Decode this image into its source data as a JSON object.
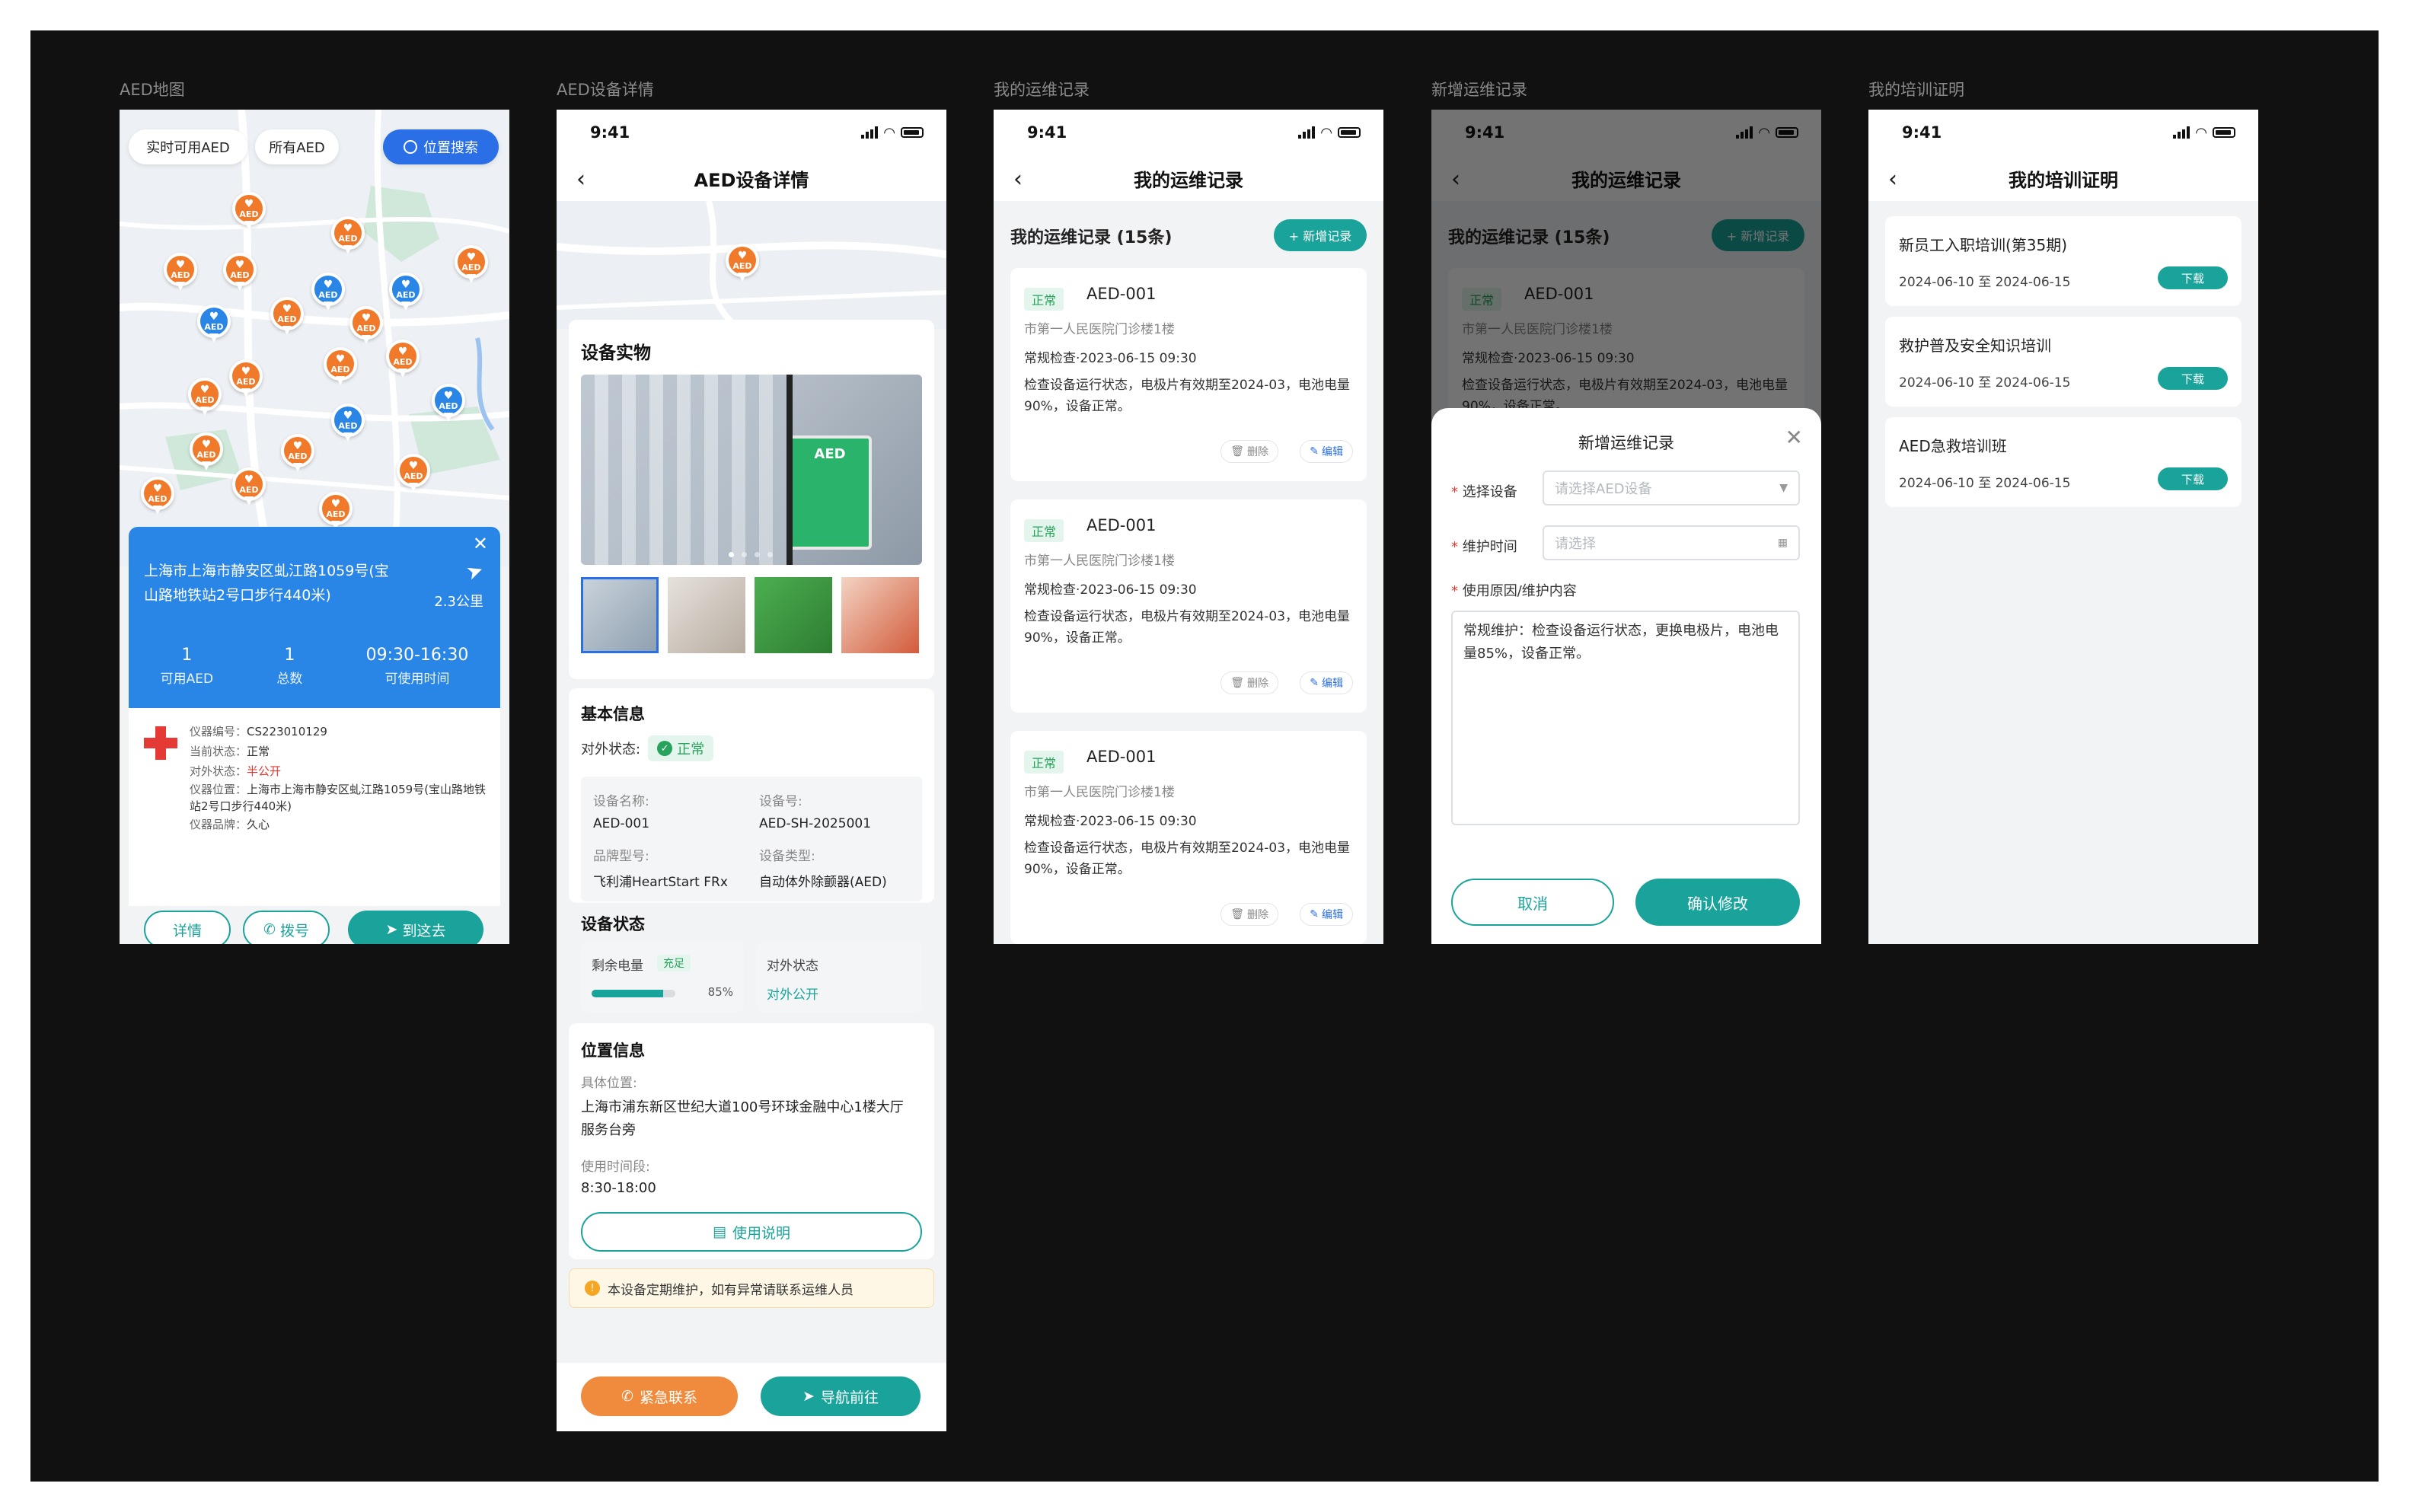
{
  "status_time": "9:41",
  "screens": {
    "map": {
      "label": "AED地图",
      "chips": [
        "实时可用AED",
        "所有AED"
      ],
      "search_label": "位置搜索",
      "pin_text": "AED",
      "panel": {
        "address": "上海市上海市静安区虬江路1059号(宝山路地铁站2号口步行440米)",
        "distance": "2.3公里",
        "stats": [
          {
            "value": "1",
            "label": "可用AED"
          },
          {
            "value": "1",
            "label": "总数"
          },
          {
            "value": "09:30-16:30",
            "label": "可使用时间"
          }
        ]
      },
      "info": [
        {
          "k": "仪器编号：",
          "v": "CS223010129"
        },
        {
          "k": "当前状态：",
          "v": "正常"
        },
        {
          "k": "对外状态：",
          "v": "半公开"
        },
        {
          "k": "仪器位置：",
          "v": "上海市上海市静安区虬江路1059号(宝山路地铁站2号口步行440米)"
        },
        {
          "k": "仪器品牌：",
          "v": "久心"
        }
      ],
      "buttons": [
        "详情",
        "拨号",
        "到这去"
      ],
      "colors": {
        "orange": "#f07a2a",
        "blue": "#2a86e6",
        "panel": "#2a86e6"
      }
    },
    "detail": {
      "label": "AED设备详情",
      "title": "AED设备详情",
      "photo_section": "设备实物",
      "photo_sign": "AED",
      "basic_title": "基本信息",
      "external_label": "对外状态:",
      "external_value": "正常",
      "fields": [
        {
          "k": "设备名称:",
          "v": "AED-001"
        },
        {
          "k": "设备号:",
          "v": "AED-SH-2025001"
        },
        {
          "k": "品牌型号:",
          "v": "飞利浦HeartStart FRx"
        },
        {
          "k": "设备类型:",
          "v": "自动体外除颤器(AED)"
        }
      ],
      "status_title": "设备状态",
      "battery_label": "剩余电量",
      "battery_tag": "充足",
      "battery_percent_text": "85%",
      "battery_level": 0.85,
      "open_label": "对外状态",
      "open_value": "对外公开",
      "location_title": "位置信息",
      "loc_label": "具体位置:",
      "loc_value": "上海市浦东新区世纪大道100号环球金融中心1楼大厅服务台旁",
      "time_label": "使用时间段:",
      "time_value": "8:30-18:00",
      "manual_btn": "使用说明",
      "notice": "本设备定期维护，如有异常请联系运维人员",
      "emergency_btn": "紧急联系",
      "nav_btn": "导航前往"
    },
    "records": {
      "label": "我的运维记录",
      "title": "我的运维记录",
      "heading": "我的运维记录 (15条)",
      "add_btn": "+ 新增记录",
      "items": [
        {
          "tag": "正常",
          "device": "AED-001",
          "place": "市第一人民医院门诊楼1楼",
          "check": "常规检查·2023-06-15 09:30",
          "desc": "检查设备运行状态，电极片有效期至2024-03，电池电量90%，设备正常。"
        },
        {
          "tag": "正常",
          "device": "AED-001",
          "place": "市第一人民医院门诊楼1楼",
          "check": "常规检查·2023-06-15 09:30",
          "desc": "检查设备运行状态，电极片有效期至2024-03，电池电量90%，设备正常。"
        },
        {
          "tag": "正常",
          "device": "AED-001",
          "place": "市第一人民医院门诊楼1楼",
          "check": "常规检查·2023-06-15 09:30",
          "desc": "检查设备运行状态，电极片有效期至2024-03，电池电量90%，设备正常。"
        }
      ],
      "delete_label": "删除",
      "edit_label": "编辑"
    },
    "add": {
      "label": "新增运维记录",
      "modal_title": "新增运维记录",
      "device_label": "选择设备",
      "device_placeholder": "请选择AED设备",
      "time_label": "维护时间",
      "time_placeholder": "请选择",
      "reason_label": "使用原因/维护内容",
      "reason_value": "常规维护：检查设备运行状态，更换电极片，电池电量85%，设备正常。",
      "cancel_btn": "取消",
      "confirm_btn": "确认修改"
    },
    "cert": {
      "label": "我的培训证明",
      "title": "我的培训证明",
      "items": [
        {
          "name": "新员工入职培训(第35期)",
          "date": "2024-06-10 至 2024-06-15"
        },
        {
          "name": "救护普及安全知识培训",
          "date": "2024-06-10 至 2024-06-15"
        },
        {
          "name": "AED急救培训班",
          "date": "2024-06-10 至 2024-06-15"
        }
      ],
      "download_label": "下载"
    }
  },
  "accent": "#1aa39a"
}
